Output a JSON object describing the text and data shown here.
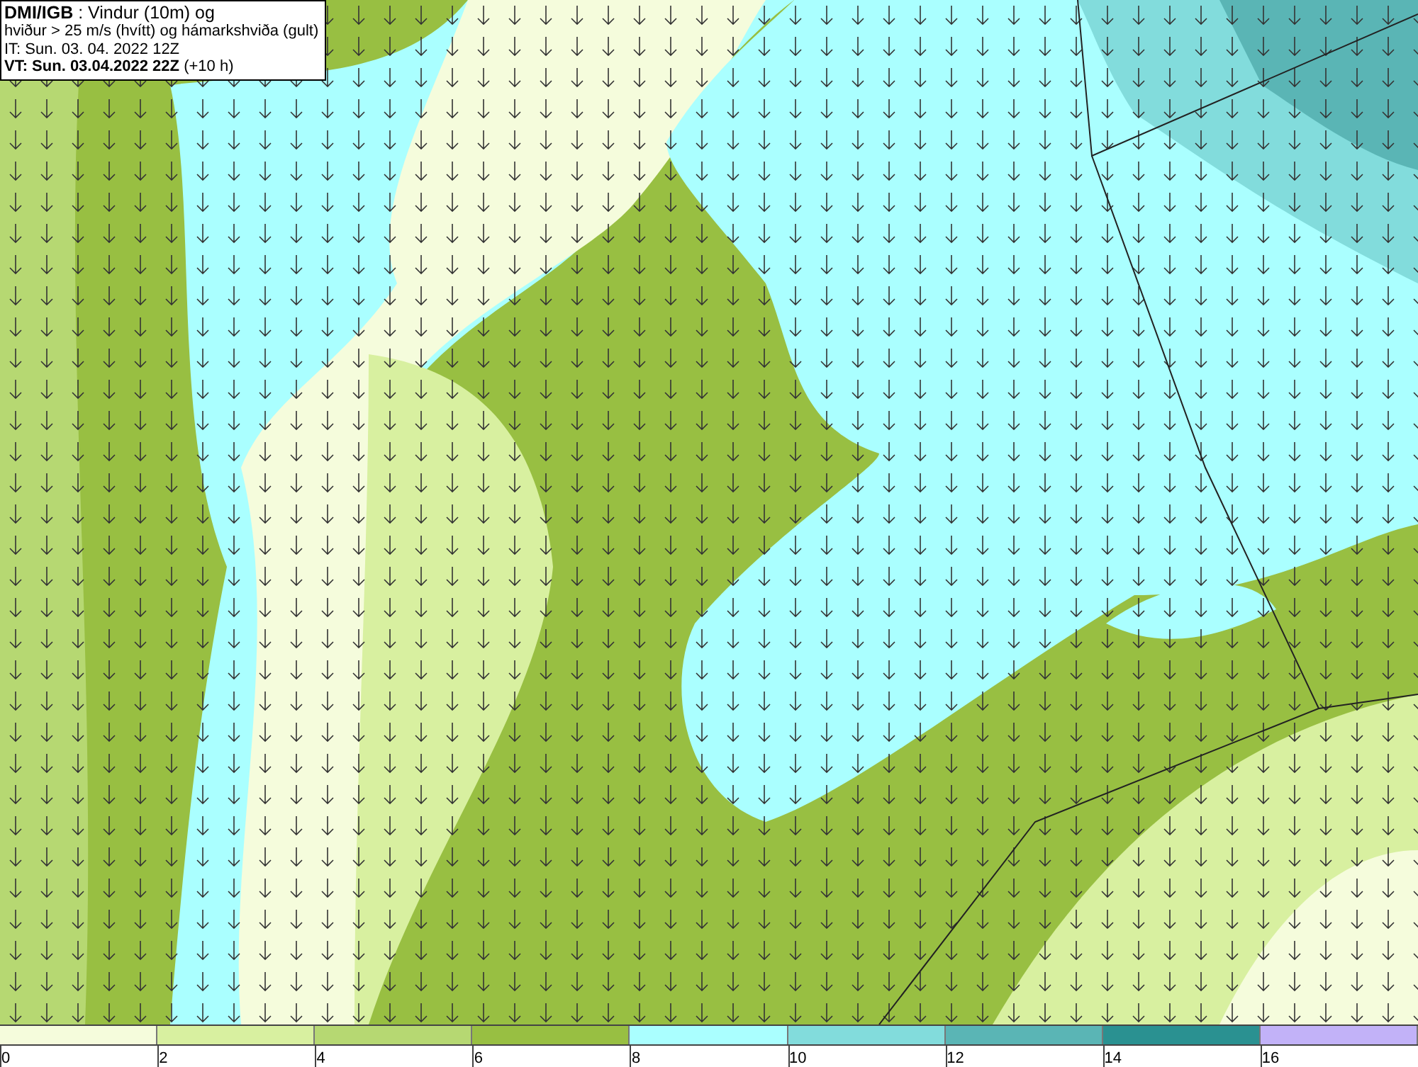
{
  "header": {
    "lines": [
      "**DMI/IGB** : Vindur (10m) og",
      "hviður > 25 m/s (hvítt) og hámarkshviða (gult)",
      "IT: Sun. 03. 04. 2022 12Z",
      "**VT: Sun. 03.04.2022 22Z** (+10 h)"
    ]
  },
  "legend": {
    "bins": [
      {
        "color": "#f5fcdc"
      },
      {
        "color": "#d8f0a0"
      },
      {
        "color": "#b6d872"
      },
      {
        "color": "#98bf42"
      },
      {
        "color": "#aaffff"
      },
      {
        "color": "#82dcdc"
      },
      {
        "color": "#5ab5b5"
      },
      {
        "color": "#2a9191"
      },
      {
        "color": "#c2b2f8"
      }
    ],
    "ticks": [
      "0",
      "2",
      "4",
      "6",
      "8",
      "10",
      "12",
      "14",
      "16"
    ]
  }
}
